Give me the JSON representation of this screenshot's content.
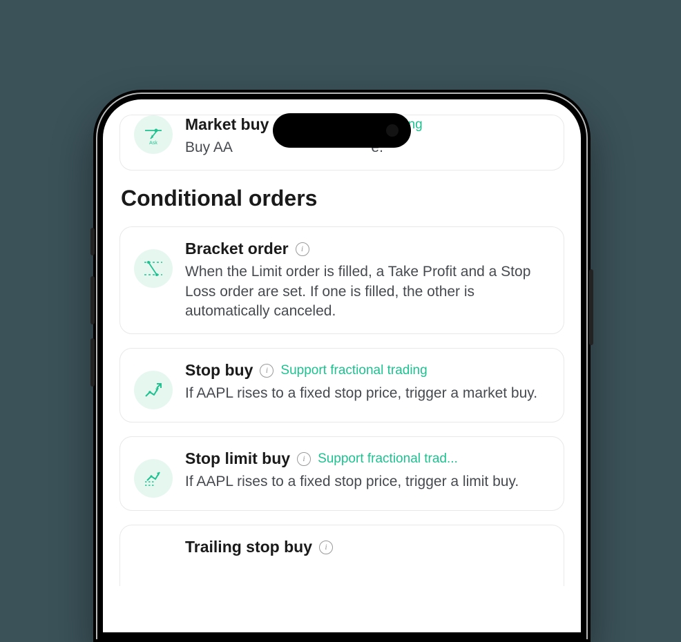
{
  "market_buy": {
    "title": "Market buy",
    "badge": "Support fractional trading",
    "desc_prefix": "Buy AA",
    "desc_suffix": "e.",
    "icon_label": "Ask"
  },
  "section_title": "Conditional orders",
  "orders": [
    {
      "title": "Bracket order",
      "badge": "",
      "desc": "When the Limit order is filled, a Take Profit and a Stop Loss order are set. If one is filled, the other is automatically canceled."
    },
    {
      "title": "Stop buy",
      "badge": "Support fractional trading",
      "desc": "If AAPL rises to a fixed stop price, trigger a market buy."
    },
    {
      "title": "Stop limit buy",
      "badge": "Support fractional trad...",
      "desc": "If AAPL rises to a fixed stop price, trigger a limit buy."
    },
    {
      "title": "Trailing stop buy",
      "badge": "",
      "desc": ""
    }
  ]
}
